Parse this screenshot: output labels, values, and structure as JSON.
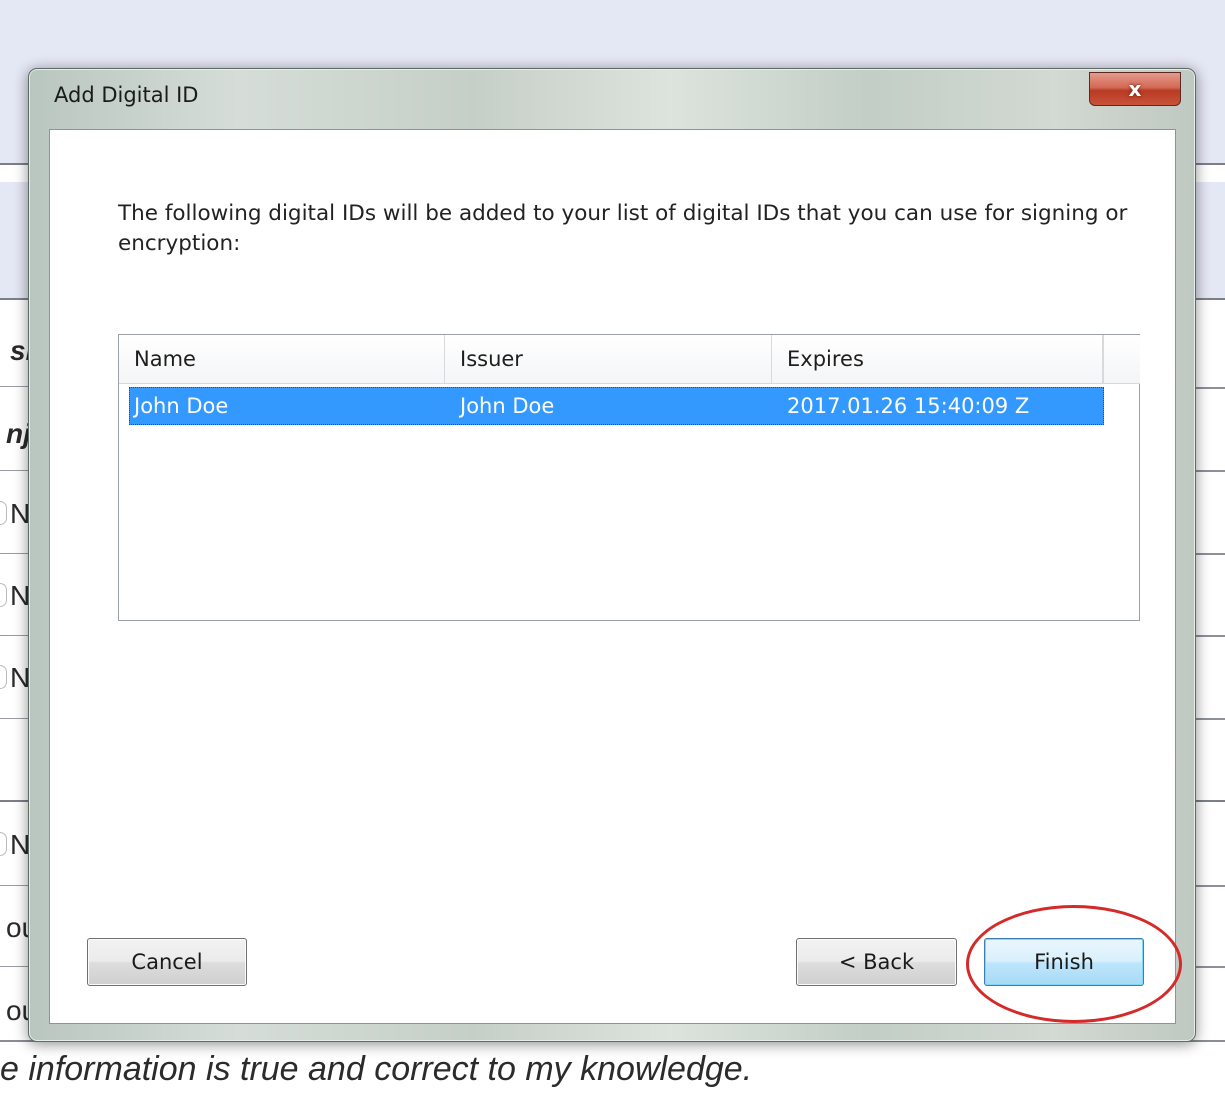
{
  "background": {
    "left_fragments": [
      "sl",
      "nj",
      "N",
      "N",
      "N",
      "N",
      "ou",
      "ou"
    ],
    "bottom_text": "e information is true and correct to my knowledge."
  },
  "dialog": {
    "title": "Add Digital ID",
    "close_label": "x",
    "description": "The following digital IDs will be added to your list of digital IDs that you can use for signing or encryption:",
    "columns": [
      "Name",
      "Issuer",
      "Expires"
    ],
    "rows": [
      {
        "name": "John Doe",
        "issuer": "John Doe",
        "expires": "2017.01.26 15:40:09 Z",
        "selected": true
      }
    ],
    "buttons": {
      "cancel": "Cancel",
      "back": "< Back",
      "finish": "Finish"
    }
  },
  "colors": {
    "selection": "#3399ff",
    "annotation_circle": "#d42a2a"
  }
}
